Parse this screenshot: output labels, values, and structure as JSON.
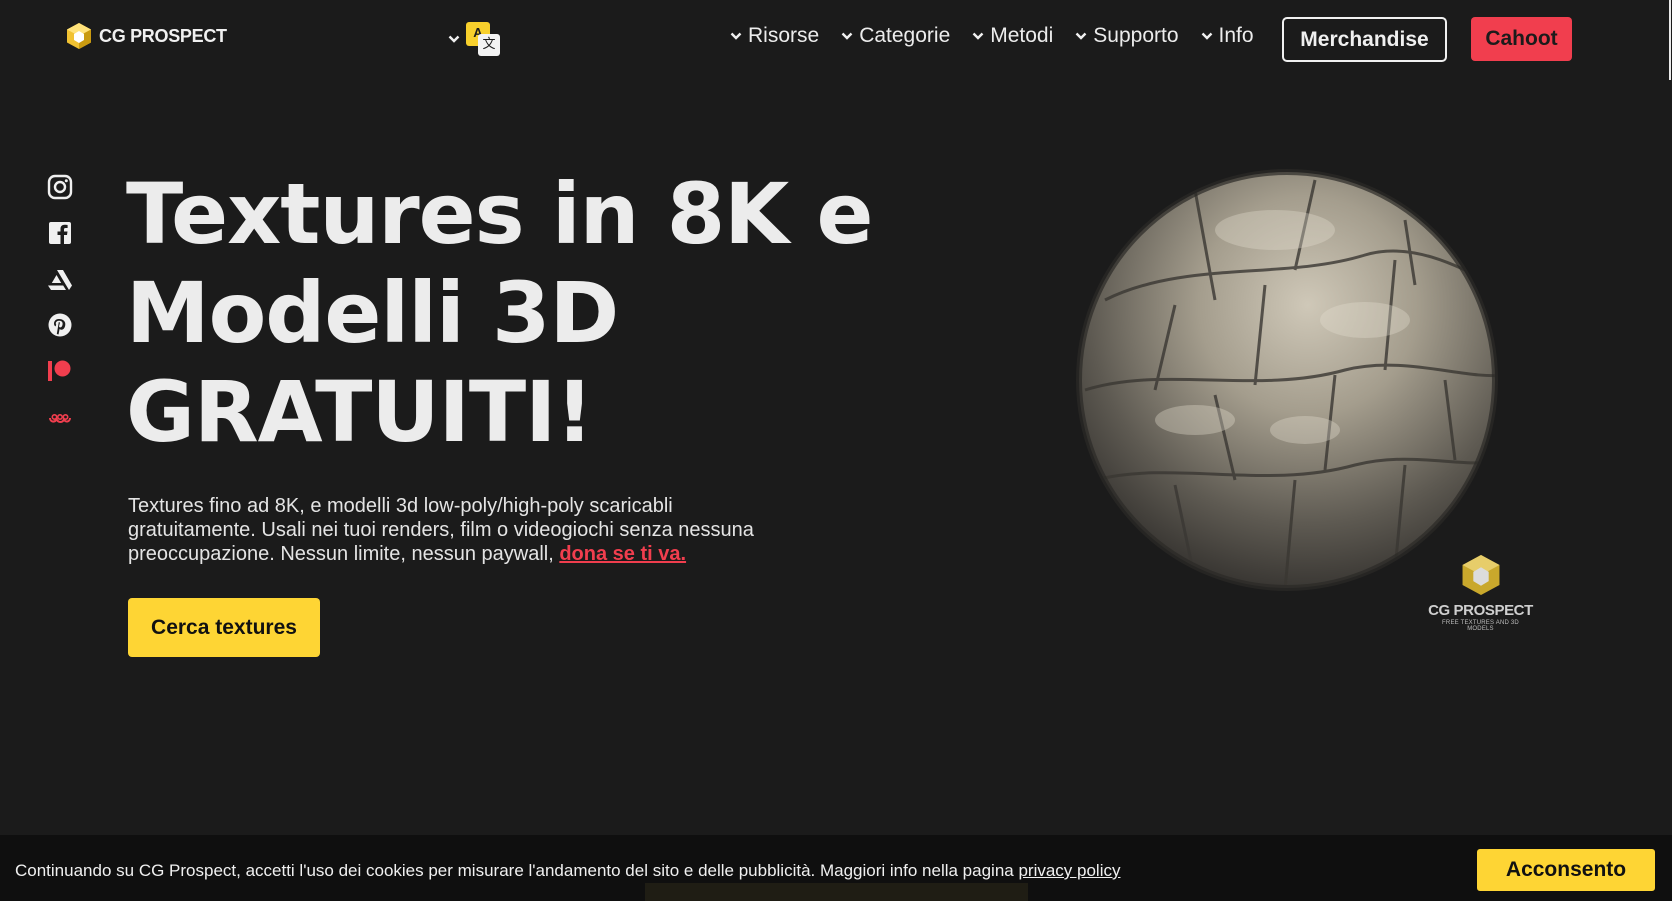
{
  "header": {
    "logo_text": "CG PROSPECT",
    "language_icon": "translate-icon",
    "language_label_a": "A",
    "language_label_b": "文",
    "nav": [
      {
        "label": "Risorse",
        "icon": "chevron-down-icon"
      },
      {
        "label": "Categorie",
        "icon": "chevron-down-icon"
      },
      {
        "label": "Metodi",
        "icon": "chevron-down-icon"
      },
      {
        "label": "Supporto",
        "icon": "chevron-down-icon"
      },
      {
        "label": "Info",
        "icon": "chevron-down-icon"
      }
    ],
    "merch_label": "Merchandise",
    "cahoot_label": "Cahoot"
  },
  "social": [
    "instagram-icon",
    "facebook-icon",
    "artstation-icon",
    "pinterest-icon",
    "patreon-icon",
    "cahoot-icon"
  ],
  "hero": {
    "title_line1": "Textures in 8K e",
    "title_line2": "Modelli 3D",
    "title_line3": "GRATUITI!",
    "text": "Textures fino ad 8K, e modelli 3d low-poly/high-poly scaricabli gratuitamente. Usali nei tuoi renders, film o videogiochi senza nessuna preoccupazione. Nessun limite, nessun paywall, ",
    "link": "dona se ti va.",
    "cta": "Cerca textures"
  },
  "watermark": {
    "title": "CG PROSPECT",
    "subtitle": "FREE TEXTURES AND 3D MODELS"
  },
  "cookie": {
    "text": "Continuando su CG Prospect, accetti l'uso dei cookies per misurare l'andamento del sito e delle pubblicità. Maggiori info nella pagina ",
    "link": "privacy policy",
    "accept": "Acconsento"
  },
  "colors": {
    "background": "#1b1b1b",
    "accent_yellow": "#fed534",
    "accent_red": "#f13e4e"
  }
}
